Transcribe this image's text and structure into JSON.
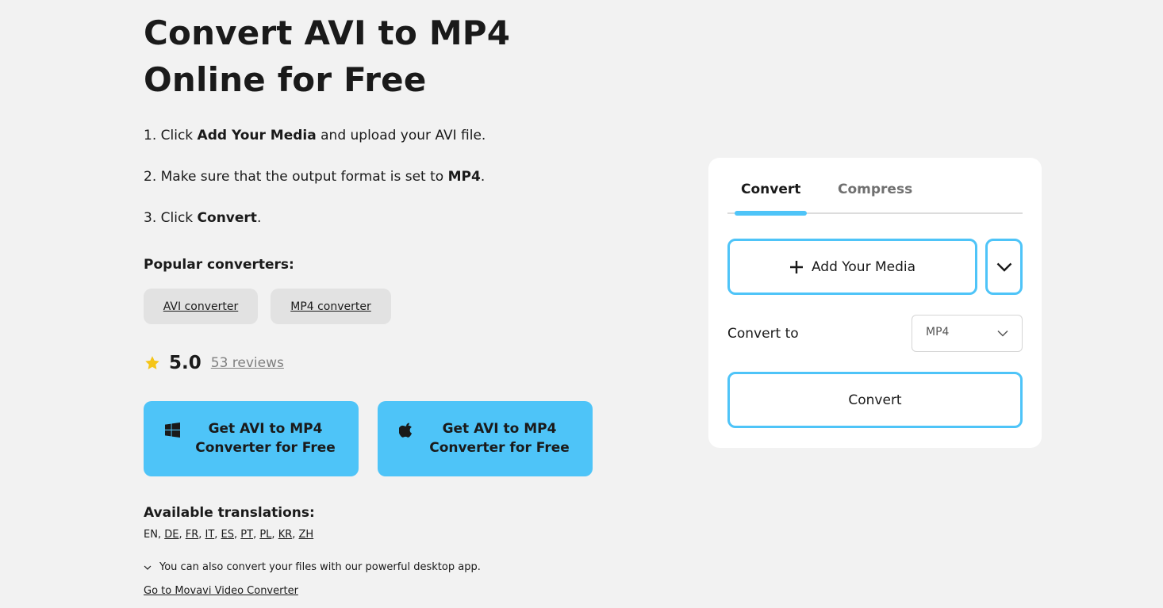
{
  "title": {
    "line1": "Convert AVI to MP4",
    "line2": "Online for Free"
  },
  "steps": [
    {
      "prefix": "1. Click ",
      "bold": "Add Your Media",
      "suffix": " and upload your AVI file."
    },
    {
      "prefix": "2. Make sure that the output format is set to ",
      "bold": "MP4",
      "suffix": "."
    },
    {
      "prefix": "3. Click ",
      "bold": "Convert",
      "suffix": "."
    }
  ],
  "popular": {
    "title": "Popular converters:",
    "items": [
      "AVI converter",
      "MP4 converter"
    ]
  },
  "rating": {
    "value": "5.0",
    "reviews": "53 reviews",
    "star_color": "#f5c518"
  },
  "downloads": [
    {
      "platform_icon": "windows-icon",
      "label_line1": "Get AVI to MP4",
      "label_line2": "Converter for Free"
    },
    {
      "platform_icon": "apple-icon",
      "label_line1": "Get AVI to MP4",
      "label_line2": "Converter for Free"
    }
  ],
  "translations": {
    "title": "Available translations:",
    "current": "EN",
    "links": [
      "DE",
      "FR",
      "IT",
      "ES",
      "PT",
      "PL",
      "KR",
      "ZH"
    ]
  },
  "desktop": {
    "note": "You can also convert your files with our powerful desktop app.",
    "link": "Go to Movavi Video Converter"
  },
  "card": {
    "tabs": [
      "Convert",
      "Compress"
    ],
    "active_tab": "Convert",
    "add_media_label": "Add Your Media",
    "convert_to_label": "Convert to",
    "format_value": "MP4",
    "convert_button": "Convert"
  },
  "colors": {
    "accent": "#4ec4f8",
    "background": "#f2f2f2",
    "chip": "#e2e2e2"
  }
}
